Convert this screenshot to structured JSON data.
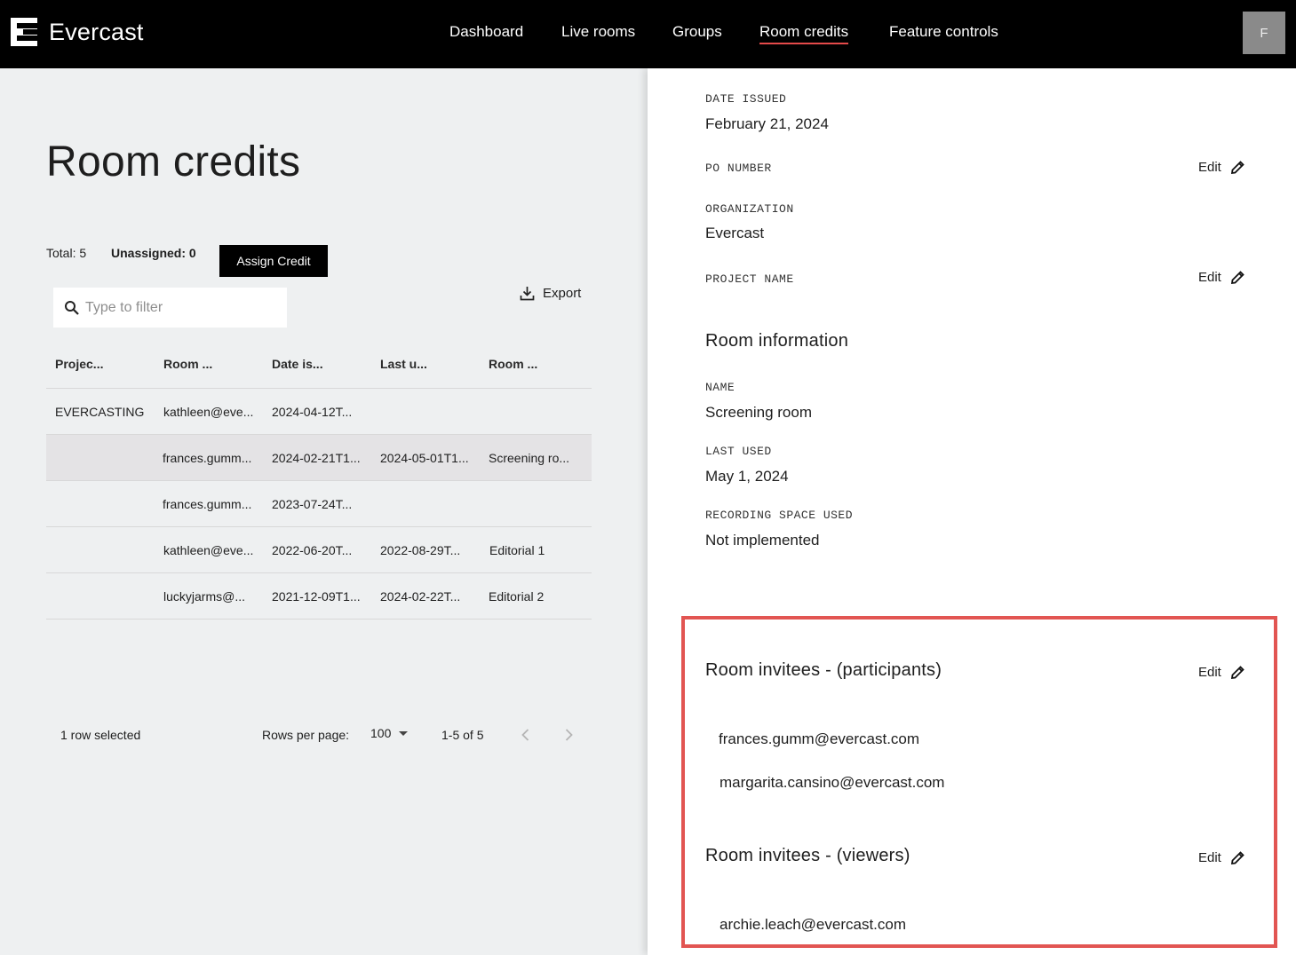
{
  "app": {
    "name": "Evercast"
  },
  "nav": {
    "items": [
      {
        "label": "Dashboard"
      },
      {
        "label": "Live rooms"
      },
      {
        "label": "Groups"
      },
      {
        "label": "Room credits"
      },
      {
        "label": "Feature controls"
      }
    ],
    "active": "Room credits",
    "avatar_initial": "F"
  },
  "page": {
    "title": "Room credits",
    "total": "Total: 5",
    "unassigned": "Unassigned: 0",
    "assign_button": "Assign Credit",
    "filter_placeholder": "Type to filter",
    "export_label": "Export"
  },
  "table": {
    "columns": [
      "Projec...",
      "Room ...",
      "Date is...",
      "Last u...",
      "Room ..."
    ],
    "rows": [
      {
        "project": "EVERCASTING",
        "room": "kathleen@eve...",
        "date_issued": "2024-04-12T...",
        "last_used": "",
        "room_name": "",
        "selected": false
      },
      {
        "project": "",
        "room": "frances.gumm...",
        "date_issued": "2024-02-21T1...",
        "last_used": "2024-05-01T1...",
        "room_name": "Screening ro...",
        "selected": true
      },
      {
        "project": "",
        "room": "frances.gumm...",
        "date_issued": "2023-07-24T...",
        "last_used": "",
        "room_name": "",
        "selected": false
      },
      {
        "project": "",
        "room": "kathleen@eve...",
        "date_issued": "2022-06-20T...",
        "last_used": "2022-08-29T...",
        "room_name": "Editorial 1",
        "selected": false
      },
      {
        "project": "",
        "room": "luckyjarms@...",
        "date_issued": "2021-12-09T1...",
        "last_used": "2024-02-22T...",
        "room_name": "Editorial 2",
        "selected": false
      }
    ],
    "footer": {
      "selected_text": "1 row selected",
      "rows_per_page_label": "Rows per page:",
      "rows_per_page_value": "100",
      "range": "1-5 of 5"
    }
  },
  "detail": {
    "date_issued_label": "DATE ISSUED",
    "date_issued_value": "February 21, 2024",
    "po_number_label": "PO NUMBER",
    "organization_label": "ORGANIZATION",
    "organization_value": "Evercast",
    "project_name_label": "PROJECT NAME",
    "edit_label": "Edit",
    "room_info_title": "Room information",
    "name_label": "NAME",
    "name_value": "Screening room",
    "last_used_label": "LAST USED",
    "last_used_value": "May 1, 2024",
    "recording_label": "RECORDING SPACE USED",
    "recording_value": "Not implemented",
    "participants_title": "Room invitees - (participants)",
    "participants": [
      "frances.gumm@evercast.com",
      "margarita.cansino@evercast.com"
    ],
    "viewers_title": "Room invitees - (viewers)",
    "viewers": [
      "archie.leach@evercast.com"
    ]
  },
  "colors": {
    "accent": "#e44a4a",
    "highlight_border": "#e25552",
    "selected_row": "#e4e3e5"
  }
}
